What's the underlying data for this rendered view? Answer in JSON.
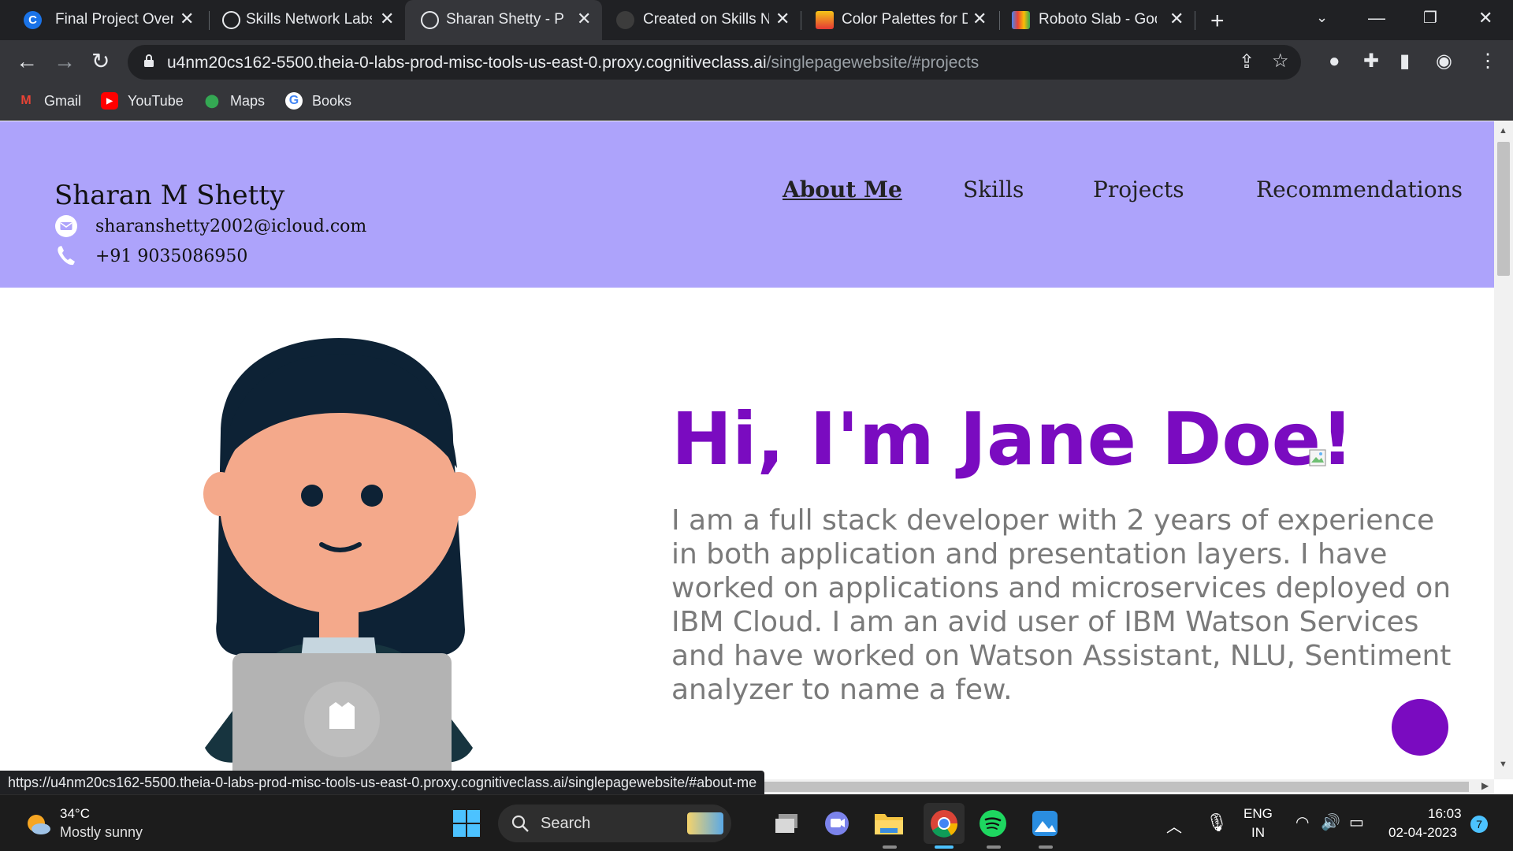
{
  "browser": {
    "tabs": [
      {
        "title": "Final Project Overvi",
        "icon": "coursera-icon",
        "icon_text": "C"
      },
      {
        "title": "Skills Network Labs",
        "icon": "globe-icon"
      },
      {
        "title": "Sharan Shetty - Por",
        "icon": "globe-icon"
      },
      {
        "title": "Created on Skills N",
        "icon": "github-icon"
      },
      {
        "title": "Color Palettes for D",
        "icon": "palette-icon"
      },
      {
        "title": "Roboto Slab - Goog",
        "icon": "google-fonts-icon"
      }
    ],
    "url_main": "u4nm20cs162-5500.theia-0-labs-prod-misc-tools-us-east-0.proxy.cognitiveclass.ai",
    "url_path": "/singlepagewebsite/#projects",
    "bookmarks": [
      {
        "label": "Gmail",
        "icon": "gmail-icon"
      },
      {
        "label": "YouTube",
        "icon": "youtube-icon"
      },
      {
        "label": "Maps",
        "icon": "maps-icon"
      },
      {
        "label": "Books",
        "icon": "google-icon"
      }
    ],
    "status_url": "https://u4nm20cs162-5500.theia-0-labs-prod-misc-tools-us-east-0.proxy.cognitiveclass.ai/singlepagewebsite/#about-me"
  },
  "page": {
    "name": "Sharan M Shetty",
    "email": "sharanshetty2002@icloud.com",
    "phone": "+91 9035086950",
    "nav": [
      "About Me",
      "Skills",
      "Projects",
      "Recommendations"
    ],
    "hero_title": "Hi, I'm Jane Doe!",
    "hero_text": "I am a full stack developer with 2 years of experience in both application and presentation layers. I have worked on applications and microservices deployed on IBM Cloud. I am an avid user of IBM Watson Services and have worked on Watson Assistant, NLU, Sentiment analyzer to name a few.",
    "colors": {
      "header_bg": "#ada3fb",
      "accent": "#7a0bc0",
      "body_text": "#7a7a7a"
    }
  },
  "taskbar": {
    "temperature": "34°C",
    "weather": "Mostly sunny",
    "search_label": "Search",
    "lang_top": "ENG",
    "lang_bottom": "IN",
    "time": "16:03",
    "date": "02-04-2023",
    "notification_count": "7"
  }
}
